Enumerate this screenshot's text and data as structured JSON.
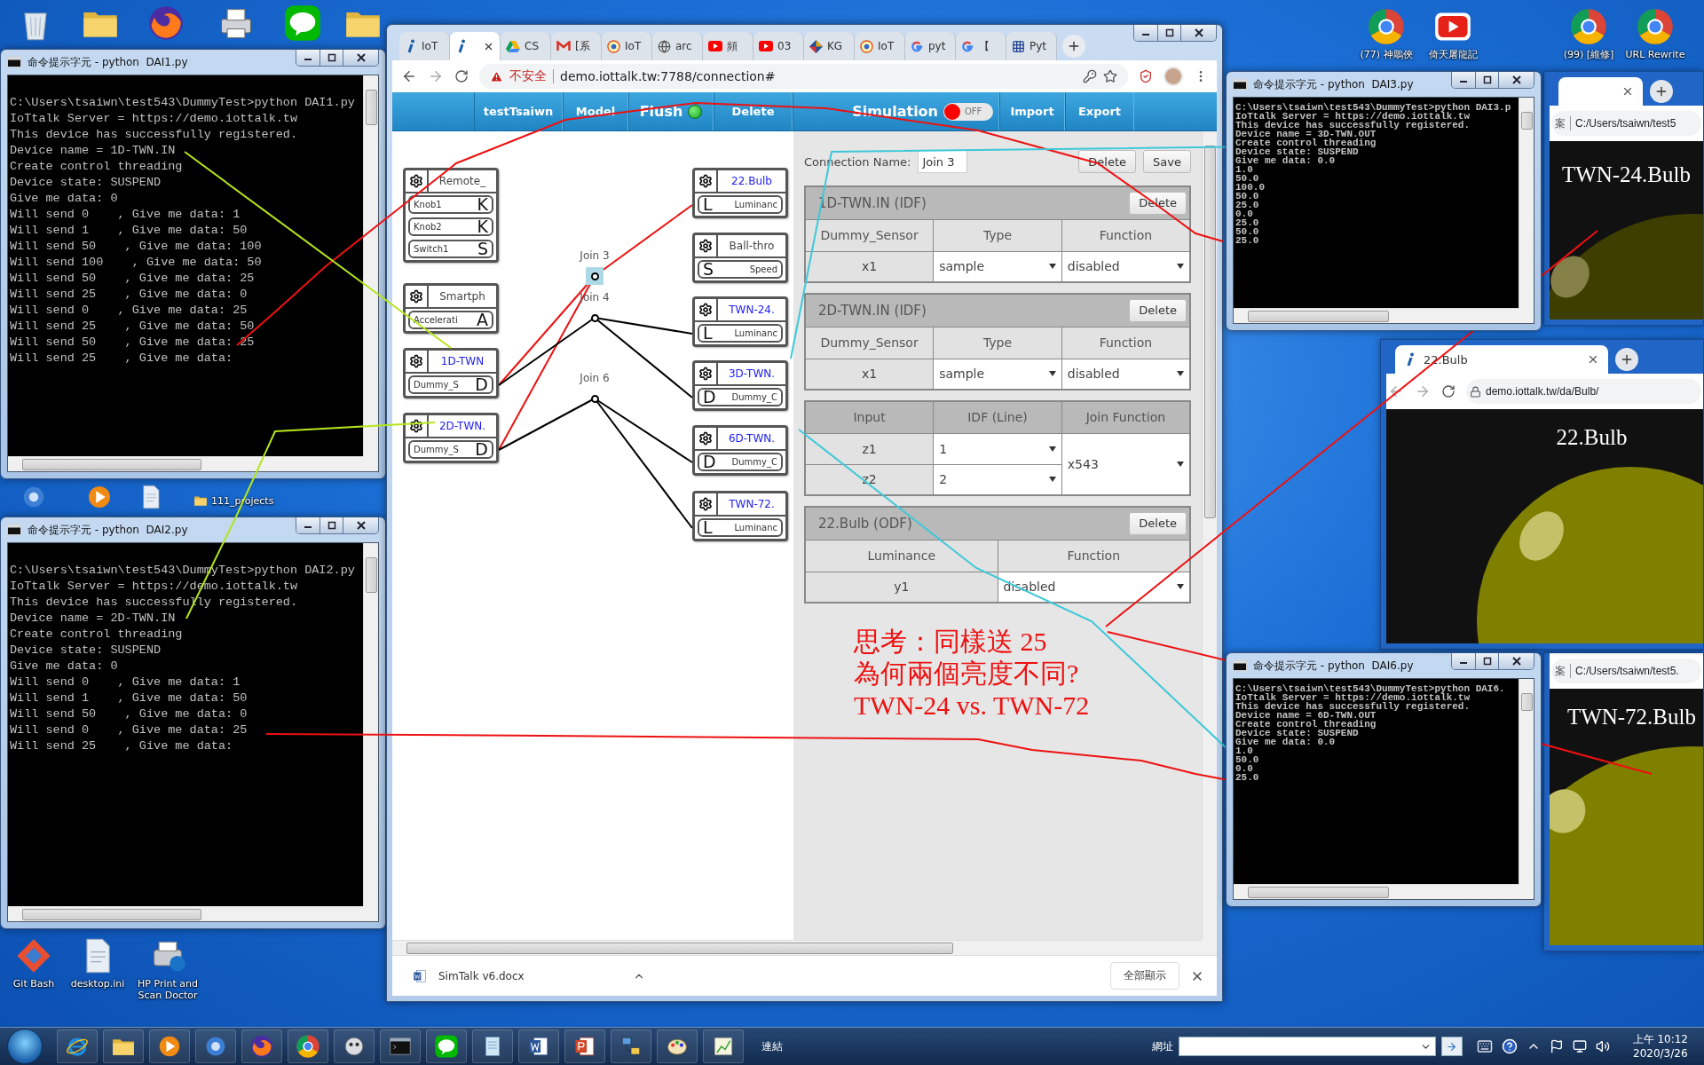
{
  "desktop": {
    "top_right_icons": [
      {
        "label": "(77) 神鵰俠",
        "kind": "chrome"
      },
      {
        "label": "倚天屠龍記",
        "kind": "youtube"
      },
      {
        "label": "(99) [維修]",
        "kind": "chrome"
      },
      {
        "label": "URL Rewrite",
        "kind": "chrome"
      }
    ],
    "bottom_left_icons": [
      {
        "label": "Git Bash",
        "kind": "git"
      },
      {
        "label": "desktop.ini",
        "kind": "file"
      },
      {
        "label": "HP Print and Scan Doctor",
        "kind": "hp"
      }
    ],
    "folder_label": "111_projects"
  },
  "consoles": [
    {
      "title": "命令提示字元 - python  DAI1.py",
      "lines": [
        "C:\\Users\\tsaiwn\\test543\\DummyTest>python DAI1.py",
        "IoTtalk Server = https://demo.iottalk.tw",
        "This device has successfully registered.",
        "Device name = 1D-TWN.IN",
        "Create control threading",
        "Device state: SUSPEND",
        "Give me data: 0",
        "Will send 0    , Give me data: 1",
        "Will send 1    , Give me data: 50",
        "Will send 50    , Give me data: 100",
        "Will send 100    , Give me data: 50",
        "Will send 50    , Give me data: 25",
        "Will send 25    , Give me data: 0",
        "Will send 0    , Give me data: 25",
        "Will send 25    , Give me data: 50",
        "Will send 50    , Give me data: 25",
        "Will send 25    , Give me data:"
      ]
    },
    {
      "title": "命令提示字元 - python  DAI2.py",
      "lines": [
        "C:\\Users\\tsaiwn\\test543\\DummyTest>python DAI2.py",
        "IoTtalk Server = https://demo.iottalk.tw",
        "This device has successfully registered.",
        "Device name = 2D-TWN.IN",
        "Create control threading",
        "Device state: SUSPEND",
        "Give me data: 0",
        "Will send 0    , Give me data: 1",
        "Will send 1    , Give me data: 50",
        "Will send 50    , Give me data: 0",
        "Will send 0    , Give me data: 25",
        "Will send 25    , Give me data:"
      ]
    },
    {
      "title": "命令提示字元 - python  DAI3.py",
      "lines": [
        "C:\\Users\\tsaiwn\\test543\\DummyTest>python DAI3.p",
        "IoTtalk Server = https://demo.iottalk.tw",
        "This device has successfully registered.",
        "Device name = 3D-TWN.OUT",
        "Create control threading",
        "Device state: SUSPEND",
        "Give me data: 0.0",
        "1.0",
        "50.0",
        "100.0",
        "50.0",
        "25.0",
        "0.0",
        "25.0",
        "50.0",
        "25.0"
      ]
    },
    {
      "title": "命令提示字元 - python  DAI6.py",
      "lines": [
        "C:\\Users\\tsaiwn\\test543\\DummyTest>python DAI6.",
        "IoTtalk Server = https://demo.iottalk.tw",
        "This device has successfully registered.",
        "Device name = 6D-TWN.OUT",
        "Create control threading",
        "Device state: SUSPEND",
        "Give me data: 0.0",
        "1.0",
        "50.0",
        "0.0",
        "25.0"
      ]
    }
  ],
  "browser": {
    "tabs": [
      {
        "label": "IoT",
        "selected": false
      },
      {
        "selected": true
      },
      {
        "label": "CS",
        "selected": false
      },
      {
        "label": "[系",
        "selected": false
      },
      {
        "label": "IoT",
        "selected": false
      },
      {
        "label": "arc",
        "selected": false
      },
      {
        "label": "頻",
        "selected": false
      },
      {
        "label": "03",
        "selected": false
      },
      {
        "label": "KG",
        "selected": false
      },
      {
        "label": "IoT",
        "selected": false
      },
      {
        "label": "pyt",
        "selected": false
      },
      {
        "label": "【",
        "selected": false
      },
      {
        "label": "Pyt",
        "selected": false
      }
    ],
    "address": {
      "warning": "不安全",
      "url": "demo.iottalk.tw:7788/connection#"
    },
    "nav": [
      {
        "label": "testTsaiwn",
        "kind": "link"
      },
      {
        "label": "Model",
        "kind": "link"
      },
      {
        "label": "Flush",
        "kind": "status",
        "on": true
      },
      {
        "label": "Delete",
        "kind": "link"
      },
      {
        "label": "Simulation",
        "kind": "toggle",
        "on": false,
        "toggle_label": "OFF"
      },
      {
        "label": "Import",
        "kind": "link"
      },
      {
        "label": "Export",
        "kind": "link"
      }
    ],
    "canvas": {
      "idf": [
        {
          "name": "Remote_",
          "highlighted": false,
          "ports": [
            {
              "label": "Knob1",
              "letter": "K"
            },
            {
              "label": "Knob2",
              "letter": "K"
            },
            {
              "label": "Switch1",
              "letter": "S"
            }
          ]
        },
        {
          "name": "Smartph",
          "highlighted": false,
          "ports": [
            {
              "label": "Accelerati",
              "letter": "A"
            }
          ]
        },
        {
          "name": "1D-TWN",
          "highlighted": true,
          "ports": [
            {
              "label": "Dummy_S",
              "letter": "D"
            }
          ]
        },
        {
          "name": "2D-TWN.",
          "highlighted": true,
          "ports": [
            {
              "label": "Dummy_S",
              "letter": "D"
            }
          ]
        }
      ],
      "odf": [
        {
          "name": "22.Bulb",
          "highlighted": true,
          "ports": [
            {
              "label": "Luminanc",
              "letter": "L"
            }
          ]
        },
        {
          "name": "Ball-thro",
          "highlighted": false,
          "ports": [
            {
              "label": "Speed",
              "letter": "S"
            }
          ]
        },
        {
          "name": "TWN-24.",
          "highlighted": true,
          "ports": [
            {
              "label": "Luminanc",
              "letter": "L"
            }
          ]
        },
        {
          "name": "3D-TWN.",
          "highlighted": true,
          "ports": [
            {
              "label": "Dummy_C",
              "letter": "D"
            }
          ]
        },
        {
          "name": "6D-TWN.",
          "highlighted": true,
          "ports": [
            {
              "label": "Dummy_C",
              "letter": "D"
            }
          ]
        },
        {
          "name": "TWN-72.",
          "highlighted": true,
          "ports": [
            {
              "label": "Luminanc",
              "letter": "L"
            }
          ]
        }
      ],
      "joins": [
        {
          "label": "Join 3",
          "selected": true
        },
        {
          "label": "Join 4",
          "selected": false
        },
        {
          "label": "Join 6",
          "selected": false
        }
      ]
    },
    "panel": {
      "connection_name_label": "Connection Name:",
      "connection_name": "Join 3",
      "buttons": [
        "Delete",
        "Save"
      ],
      "sections": [
        {
          "kind": "device",
          "title": "1D-TWN.IN (IDF)",
          "button": "Delete",
          "columns": [
            "Dummy_Sensor",
            "Type",
            "Function"
          ],
          "rows": [
            [
              {
                "text": "x1"
              },
              {
                "text": "sample",
                "dropdown": true
              },
              {
                "text": "disabled",
                "dropdown": true
              }
            ]
          ]
        },
        {
          "kind": "device",
          "title": "2D-TWN.IN (IDF)",
          "button": "Delete",
          "columns": [
            "Dummy_Sensor",
            "Type",
            "Function"
          ],
          "rows": [
            [
              {
                "text": "x1"
              },
              {
                "text": "sample",
                "dropdown": true
              },
              {
                "text": "disabled",
                "dropdown": true
              }
            ]
          ]
        },
        {
          "kind": "join",
          "columns": [
            "Input",
            "IDF (Line)",
            "Join Function"
          ],
          "rows": [
            {
              "input": "z1",
              "line": "1"
            },
            {
              "input": "z2",
              "line": "2"
            }
          ],
          "function": "x543"
        },
        {
          "kind": "device",
          "title": "22.Bulb (ODF)",
          "button": "Delete",
          "columns": [
            "Luminance",
            "Function"
          ],
          "rows": [
            [
              {
                "text": "y1"
              },
              {
                "text": "disabled",
                "dropdown": true
              }
            ]
          ]
        }
      ],
      "note_lines": [
        "思考：同樣送 25",
        "為何兩個亮度不同?",
        "TWN-24 vs. TWN-72"
      ]
    },
    "download": {
      "file": "SimTalk v6.docx",
      "show_all": "全部顯示"
    }
  },
  "bulb_windows": [
    {
      "tab": {
        "closable": true
      },
      "scheme": "案",
      "address": "C:/Users/tsaiwn/test5",
      "label": "TWN-24.Bulb",
      "dimmed": true
    },
    {
      "tab": {
        "title": "22.Bulb",
        "closable": true
      },
      "secure": true,
      "address": "demo.iottalk.tw/da/Bulb/",
      "label": "22.Bulb",
      "dimmed": false
    },
    {
      "scheme": "案",
      "address": "C:/Users/tsaiwn/test5.",
      "label": "TWN-72.Bulb",
      "dimmed": false
    }
  ],
  "taskbar": {
    "links_label": "連結",
    "address_label": "網址",
    "clock_time": "上午 10:12",
    "clock_date": "2020/3/26"
  }
}
